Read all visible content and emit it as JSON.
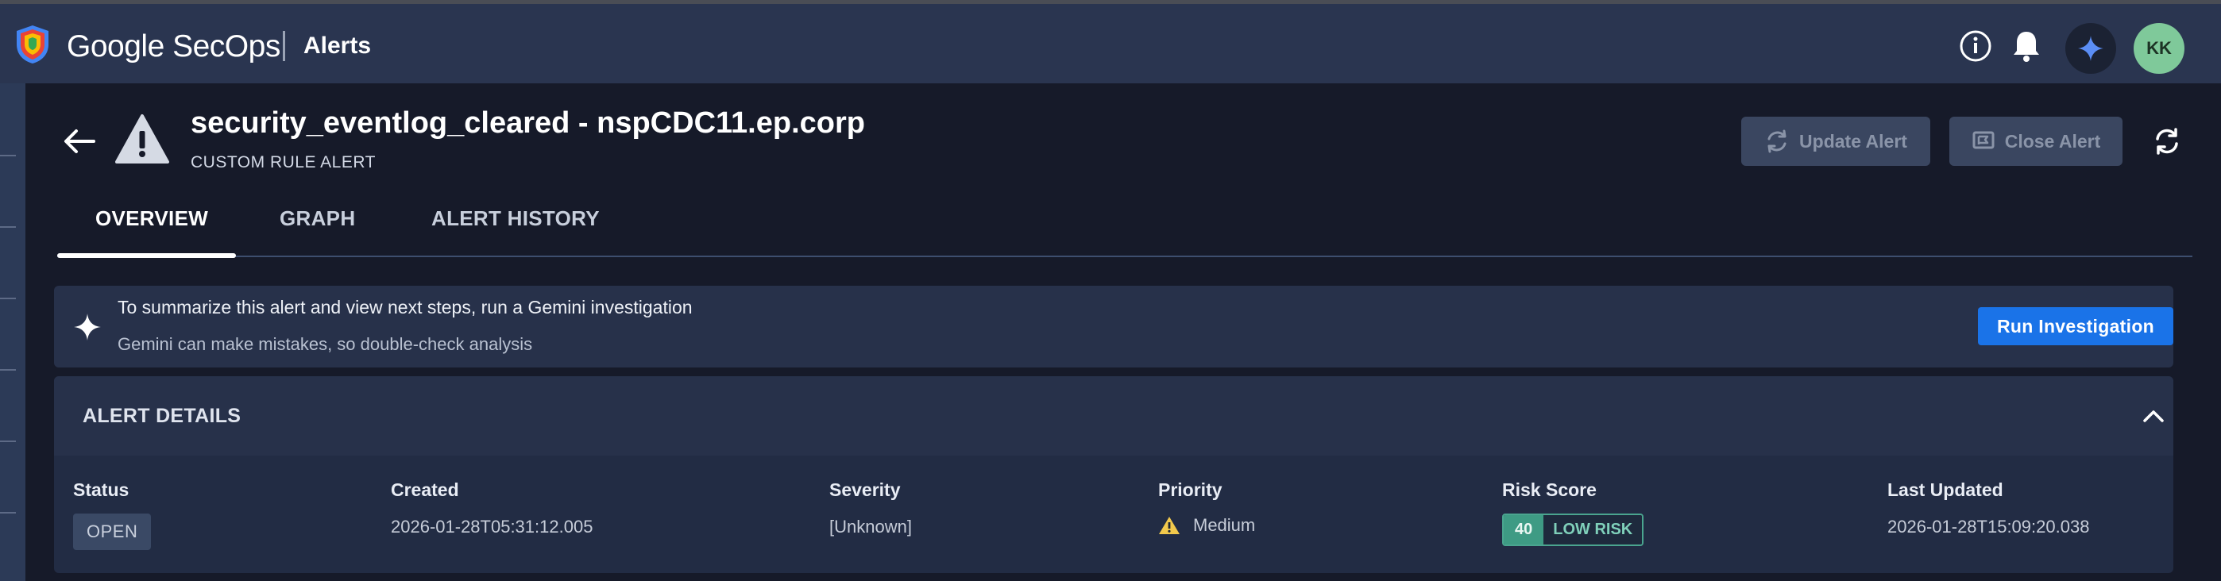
{
  "topbar": {
    "brand_google": "Google",
    "brand_secops": "SecOps",
    "section": "Alerts",
    "avatar_initials": "KK",
    "icons": [
      "info-icon",
      "bell-icon",
      "gemini-icon"
    ]
  },
  "alert": {
    "title": "security_eventlog_cleared - nspCDC11.ep.corp",
    "subtitle": "CUSTOM RULE ALERT",
    "update_label": "Update Alert",
    "close_label": "Close Alert"
  },
  "tabs": [
    {
      "label": "OVERVIEW",
      "active": true
    },
    {
      "label": "GRAPH",
      "active": false
    },
    {
      "label": "ALERT HISTORY",
      "active": false
    }
  ],
  "gemini": {
    "line1": "To summarize this alert and view next steps, run a Gemini investigation",
    "line2": "Gemini can make mistakes, so double-check analysis",
    "button": "Run Investigation"
  },
  "details": {
    "title": "ALERT DETAILS",
    "status": {
      "label": "Status",
      "value": "OPEN"
    },
    "created": {
      "label": "Created",
      "value": "2026-01-28T05:31:12.005"
    },
    "severity": {
      "label": "Severity",
      "value": "[Unknown]"
    },
    "priority": {
      "label": "Priority",
      "value": "Medium"
    },
    "risk": {
      "label": "Risk Score",
      "score": "40",
      "level": "LOW RISK"
    },
    "updated": {
      "label": "Last Updated",
      "value": "2026-01-28T15:09:20.038"
    }
  },
  "colors": {
    "topbar": "#2a3550",
    "background": "#161a29",
    "accent_button": "#1a73e8",
    "risk_teal": "#3e9b84",
    "warning": "#f2c94c"
  }
}
